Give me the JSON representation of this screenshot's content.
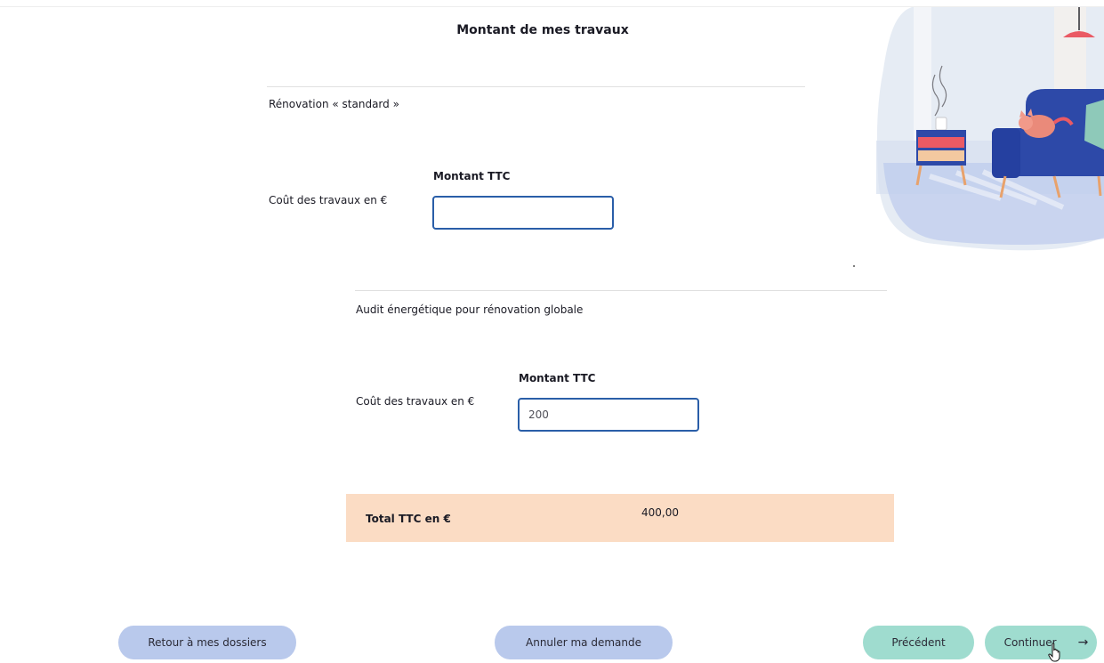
{
  "page": {
    "title": "Montant de mes travaux"
  },
  "sections": [
    {
      "title": "Rénovation « standard »",
      "column_header": "Montant TTC",
      "row_label": "Coût des travaux en €",
      "input_value": ""
    },
    {
      "title": "Audit énergétique pour rénovation globale",
      "column_header": "Montant TTC",
      "row_label": "Coût des travaux en €",
      "input_value": "200"
    }
  ],
  "total": {
    "label": "Total TTC en €",
    "value": "400,00"
  },
  "footer": {
    "back_label": "Retour à mes dossiers",
    "cancel_label": "Annuler ma demande",
    "previous_label": "Précédent",
    "continue_label": "Continuer",
    "continue_arrow": "→"
  },
  "icons": {
    "illustration": "living-room-illustration",
    "cursor": "hand-pointer-icon",
    "arrow": "arrow-right-icon"
  },
  "colors": {
    "input_border": "#2a5ea8",
    "total_background": "#fbdcc4",
    "secondary_button": "#b9c9ec",
    "primary_button": "#9fdccf",
    "illustration_background": "#e6ecf4",
    "sofa": "#2d49a8"
  }
}
